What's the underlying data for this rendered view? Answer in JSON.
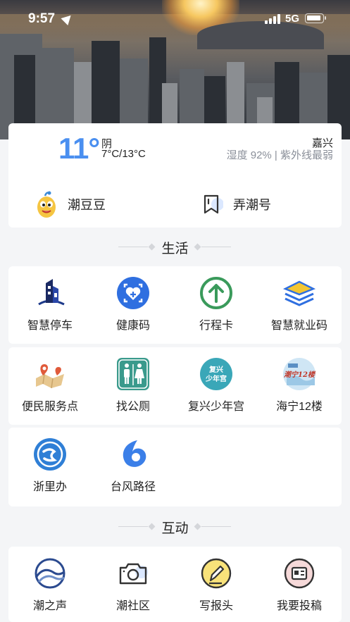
{
  "status_bar": {
    "time": "9:57",
    "network": "5G"
  },
  "weather": {
    "temperature": "11°",
    "condition": "阴",
    "range": "7°C/13°C",
    "city": "嘉兴",
    "details": "湿度 92% | 紫外线最弱"
  },
  "quick_links": [
    {
      "label": "潮豆豆",
      "icon": "mascot-icon"
    },
    {
      "label": "弄潮号",
      "icon": "bookmark-icon"
    }
  ],
  "sections": {
    "life": {
      "title": "生活",
      "items": [
        {
          "label": "智慧停车",
          "icon": "parking-building-icon"
        },
        {
          "label": "健康码",
          "icon": "health-code-icon"
        },
        {
          "label": "行程卡",
          "icon": "itinerary-arrow-icon"
        },
        {
          "label": "智慧就业码",
          "icon": "layers-icon"
        },
        {
          "label": "便民服务点",
          "icon": "map-pin-icon"
        },
        {
          "label": "找公厕",
          "icon": "restroom-icon"
        },
        {
          "label": "复兴少年宫",
          "icon": "youth-palace-badge-icon",
          "badge": "复兴少年宫"
        },
        {
          "label": "海宁12楼",
          "icon": "haining-badge-icon"
        },
        {
          "label": "浙里办",
          "icon": "zheliban-icon"
        },
        {
          "label": "台风路径",
          "icon": "typhoon-icon"
        }
      ]
    },
    "interact": {
      "title": "互动",
      "items": [
        {
          "label": "潮之声",
          "icon": "wave-logo-icon"
        },
        {
          "label": "潮社区",
          "icon": "camera-icon"
        },
        {
          "label": "写报头",
          "icon": "pencil-icon"
        },
        {
          "label": "我要投稿",
          "icon": "submit-icon"
        }
      ]
    }
  }
}
